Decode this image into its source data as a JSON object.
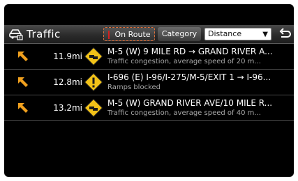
{
  "header": {
    "title": "Traffic",
    "icon": "traffic-car-icon",
    "on_route_label": "On Route",
    "category_label": "Category",
    "sort_select_value": "Distance",
    "back_icon": "back-arrow-icon"
  },
  "colors": {
    "background": "#000000",
    "accent_orange": "#f0a01e",
    "sign_yellow": "#f2c218",
    "selection_outline": "#e0703a",
    "marker_red": "#d21f1f"
  },
  "incidents": [
    {
      "direction_icon": "arrow-up-left-icon",
      "distance": "11.9mi",
      "sign_icon": "traffic-congestion-sign-icon",
      "title": "M-5 (W) 9 MILE RD → GRAND RIVER A...",
      "description": "Traffic congestion, average speed of 20 m..."
    },
    {
      "direction_icon": "arrow-up-left-icon",
      "distance": "12.8mi",
      "sign_icon": "warning-sign-icon",
      "title": "I-696 (E) I-96/I-275/M-5/EXIT 1 → I-96...",
      "description": "Ramps blocked"
    },
    {
      "direction_icon": "arrow-up-left-icon",
      "distance": "13.2mi",
      "sign_icon": "traffic-congestion-sign-icon",
      "title": "M-5 (W) GRAND RIVER AVE/10 MILE R...",
      "description": "Traffic congestion, average speed of 40 m..."
    }
  ]
}
